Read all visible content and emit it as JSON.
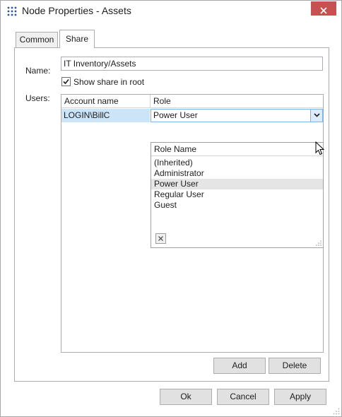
{
  "window": {
    "title": "Node Properties - Assets"
  },
  "tabs": [
    {
      "label": "Common"
    },
    {
      "label": "Share"
    }
  ],
  "share": {
    "name_label": "Name:",
    "name_value": "IT Inventory/Assets",
    "show_in_root_label": "Show share in root",
    "show_in_root_checked": true,
    "users_label": "Users:",
    "grid": {
      "columns": [
        "Account name",
        "Role"
      ],
      "rows": [
        {
          "account": "LOGIN\\BillC",
          "role": "Power User"
        }
      ]
    },
    "role_dropdown": {
      "header": "Role Name",
      "options": [
        "(Inherited)",
        "Administrator",
        "Power User",
        "Regular User",
        "Guest"
      ],
      "highlighted": "Power User"
    },
    "add_label": "Add",
    "delete_label": "Delete"
  },
  "footer": {
    "ok_label": "Ok",
    "cancel_label": "Cancel",
    "apply_label": "Apply"
  },
  "colors": {
    "close_button": "#c75050",
    "selection": "#cce4f7",
    "dropdown_highlight": "#e5e5e5",
    "app_icon": "#2b5797"
  }
}
